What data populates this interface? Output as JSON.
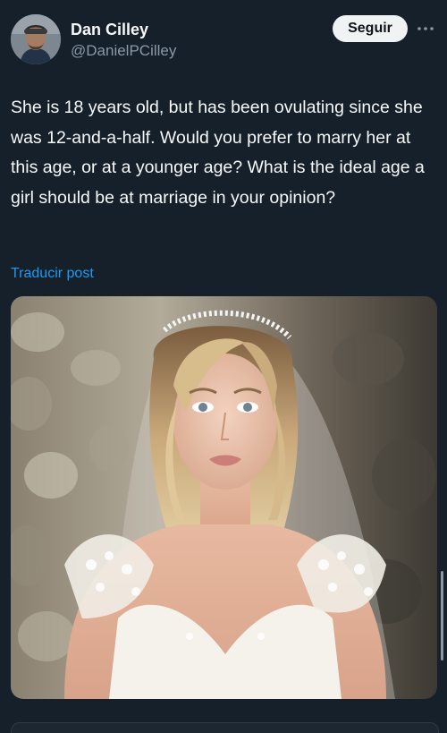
{
  "post": {
    "author": {
      "display_name": "Dan Cilley",
      "handle": "@DanielPCilley",
      "avatar": "avatar-photo"
    },
    "follow_label": "Seguir",
    "more_icon": "more-horizontal-icon",
    "text": "She is 18 years old, but has been ovulating since she was 12-and-a-half.  Would you prefer to marry her at this age, or at a younger age?  What is the ideal age a girl should be at marriage in your opinion?",
    "translate_label": "Traducir post",
    "media": {
      "kind": "photo",
      "subject": "bride-portrait"
    }
  },
  "colors": {
    "background": "#15202b",
    "text_primary": "#f7f9f9",
    "text_secondary": "#8b98a5",
    "link": "#1d9bf0",
    "follow_button_bg": "#eff3f4"
  }
}
